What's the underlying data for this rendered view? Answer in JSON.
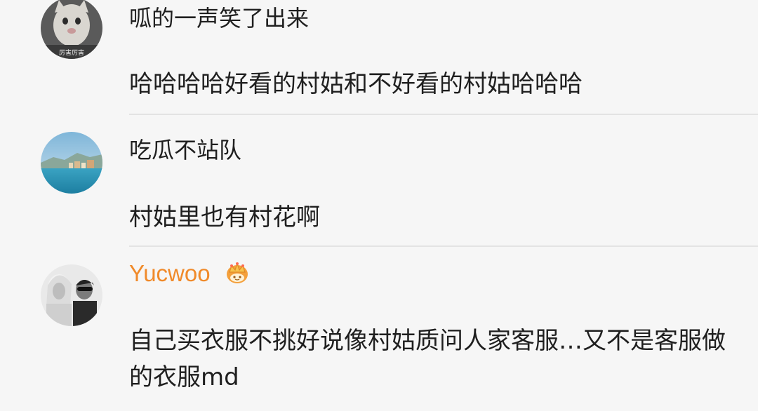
{
  "comments": [
    {
      "username": "呱的一声笑了出来",
      "text": "哈哈哈哈好看的村姑和不好看的村姑哈哈哈",
      "avatar_icon": "cat-meme-avatar",
      "avatar_caption": "厉害厉害"
    },
    {
      "username": "吃瓜不站队",
      "text": "村姑里也有村花啊",
      "avatar_icon": "lake-scenery-avatar"
    },
    {
      "username": "Yucwoo",
      "username_color": "#f08a2a",
      "badge_icon": "crown-badge-icon",
      "text": "自己买衣服不挑好说像村姑质问人家客服…又不是客服做的衣服md",
      "avatar_icon": "photo-avatar"
    }
  ]
}
